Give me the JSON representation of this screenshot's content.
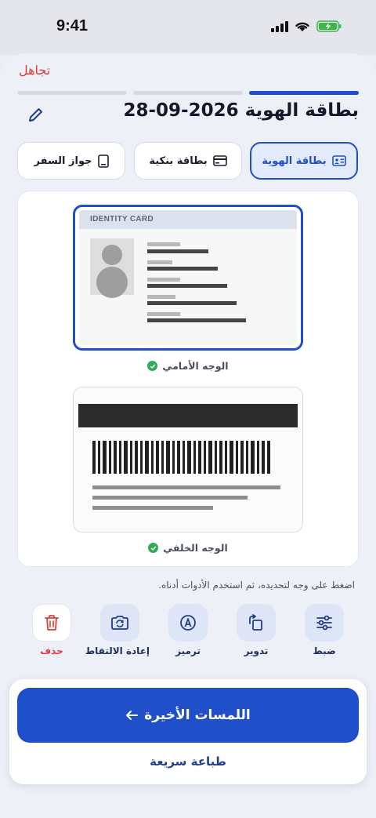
{
  "status_bar": {
    "time": "9:41"
  },
  "header": {
    "dismiss_label": "تجاهل",
    "title": "بطاقة الهوية 2026-09-28",
    "progress_steps": [
      {
        "active": true
      },
      {
        "active": false
      },
      {
        "active": false
      }
    ]
  },
  "doc_types": [
    {
      "label": "بطاقة الهوية",
      "icon": "id-card-icon",
      "selected": true
    },
    {
      "label": "بطاقة بنكية",
      "icon": "credit-card-icon",
      "selected": false
    },
    {
      "label": "جواز السفر",
      "icon": "passport-icon",
      "selected": false
    }
  ],
  "cards": {
    "front": {
      "header_text": "IDENTITY CARD",
      "caption": "الوجه الأمامي",
      "verified": true
    },
    "back": {
      "caption": "الوجه الخلفي",
      "verified": true
    }
  },
  "hint": "اضغط على وجه لتحديده، ثم استخدم الأدوات أدناه.",
  "tools": [
    {
      "label": "ضبط",
      "icon": "sliders-icon"
    },
    {
      "label": "تدوير",
      "icon": "rotate-icon"
    },
    {
      "label": "ترميز",
      "icon": "markup-icon"
    },
    {
      "label": "إعادة الالتقاط",
      "icon": "retake-camera-icon"
    },
    {
      "label": "حذف",
      "icon": "trash-icon",
      "danger": true
    }
  ],
  "actions": {
    "primary_label": "اللمسات الأخيرة",
    "secondary_label": "طباعة سريعة"
  },
  "colors": {
    "accent": "#1f4fc9",
    "danger": "#e23b3b",
    "success": "#2faa57"
  }
}
